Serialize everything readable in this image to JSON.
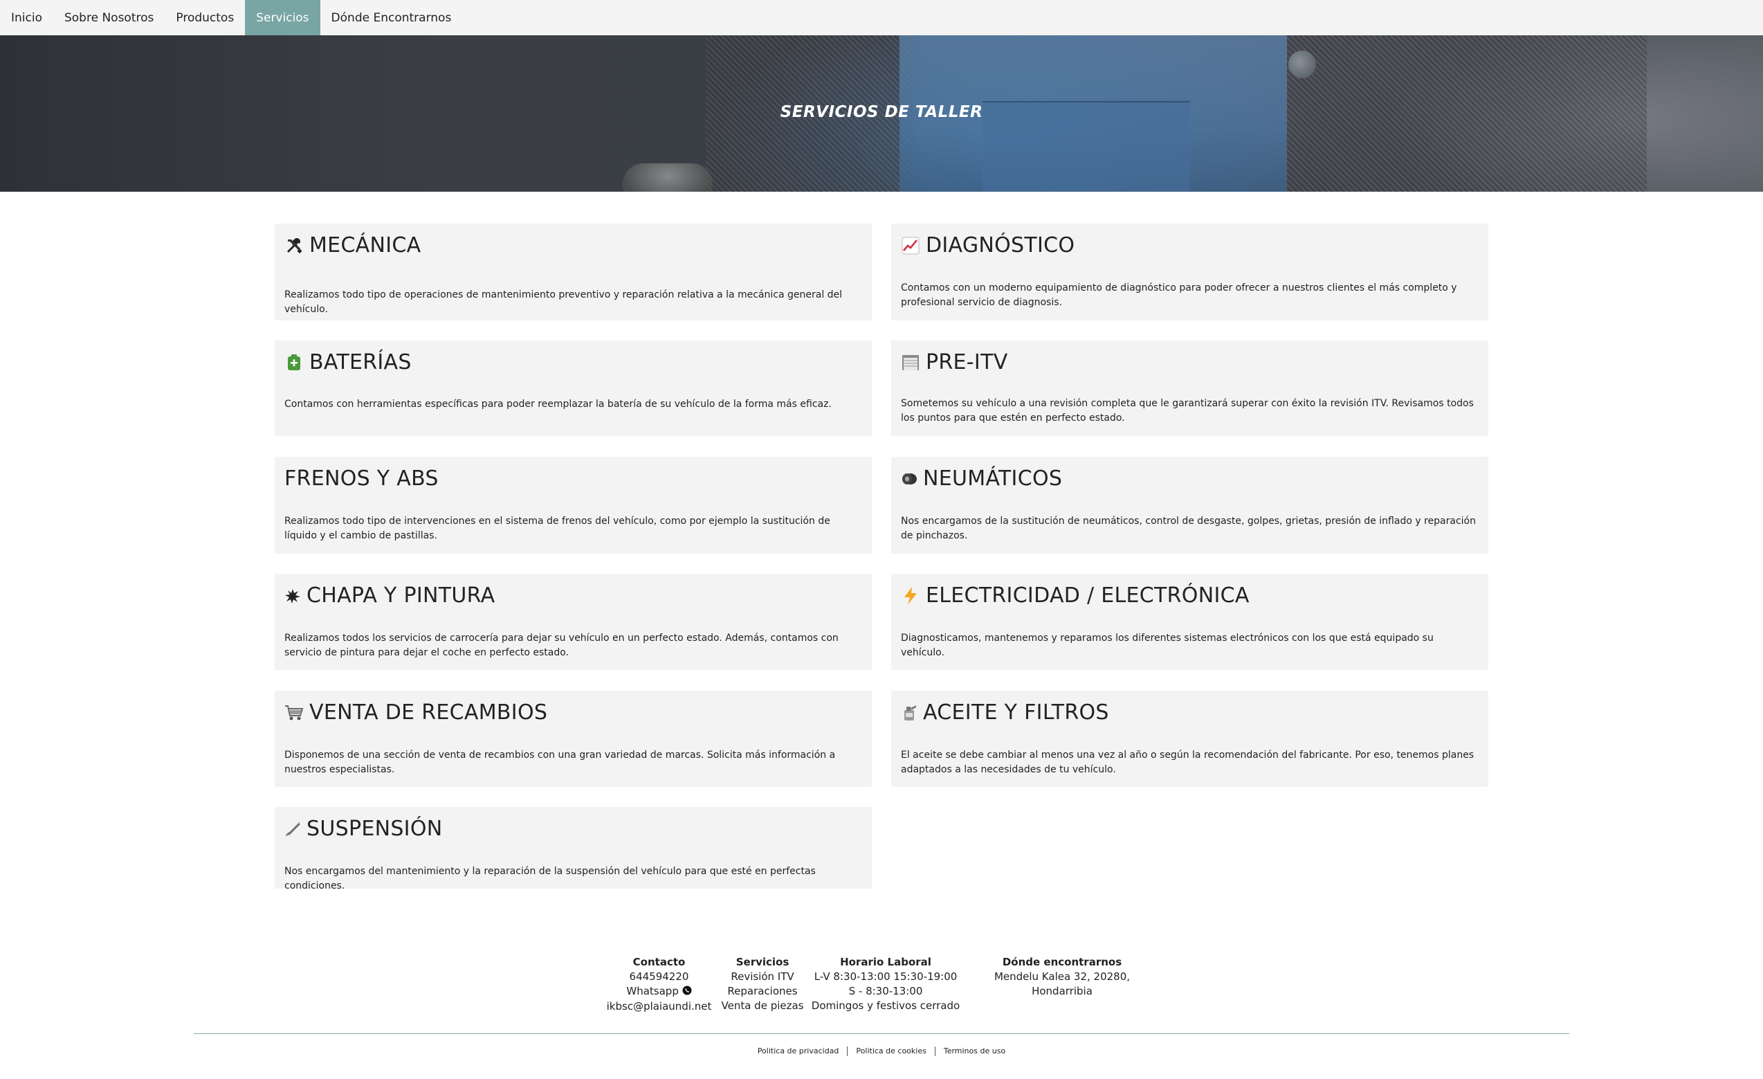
{
  "nav": {
    "items": [
      {
        "label": "Inicio"
      },
      {
        "label": "Sobre Nosotros"
      },
      {
        "label": "Productos"
      },
      {
        "label": "Servicios"
      },
      {
        "label": "Dónde Encontrarnos"
      }
    ],
    "active": "Servicios",
    "active_color": "#79a5a4"
  },
  "hero": {
    "title": "SERVICIOS DE TALLER"
  },
  "services": [
    {
      "icon": "tools-icon",
      "title": "MECÁNICA",
      "description": "Realizamos todo tipo de operaciones de mantenimiento preventivo y reparación relativa a la mecánica general del vehículo."
    },
    {
      "icon": "chart-icon",
      "title": "DIAGNÓSTICO",
      "description": "Contamos con un moderno equipamiento de diagnóstico para poder ofrecer a nuestros clientes el más completo y profesional servicio de diagnosis."
    },
    {
      "icon": "battery-icon",
      "title": "BATERÍAS",
      "description": "Contamos con herramientas específicas para poder reemplazar la batería de su vehículo de la forma más eficaz."
    },
    {
      "icon": "garage-icon",
      "title": "PRE-ITV",
      "description": "Sometemos su vehículo a una revisión completa que le garantizará superar con éxito la revisión ITV. Revisamos todos los puntos para que estén en perfecto estado."
    },
    {
      "icon": "",
      "title": "FRENOS Y ABS",
      "description": "Realizamos todo tipo de intervenciones en el sistema de frenos del vehículo, como por ejemplo la sustitución de líquido y el cambio de pastillas."
    },
    {
      "icon": "tire-icon",
      "title": "NEUMÁTICOS",
      "description": "Nos encargamos de la sustitución de neumáticos, control de desgaste, golpes, grietas, presión de inflado y reparación de pinchazos."
    },
    {
      "icon": "paint-splash-icon",
      "title": "CHAPA Y PINTURA",
      "description": "Realizamos todos los servicios de carrocería para dejar su vehículo en un perfecto estado. Además, contamos con servicio de pintura para dejar el coche en perfecto estado."
    },
    {
      "icon": "lightning-icon",
      "title": "ELECTRICIDAD / ELECTRÓNICA",
      "description": "Diagnosticamos, mantenemos y reparamos los diferentes sistemas electrónicos con los que está equipado su vehículo."
    },
    {
      "icon": "cart-icon",
      "title": "VENTA DE RECAMBIOS",
      "description": "Disponemos de una sección de venta de recambios con una gran variedad de marcas. Solicita más información a nuestros especialistas."
    },
    {
      "icon": "oil-can-icon",
      "title": "ACEITE Y FILTROS",
      "description": "El aceite se debe cambiar al menos una vez al año o según la recomendación del fabricante. Por eso, tenemos planes adaptados a las necesidades de tu vehículo."
    },
    {
      "icon": "spring-icon",
      "title": "SUSPENSIÓN",
      "description": "Nos encargamos del mantenimiento y la reparación de la suspensión del vehículo para que esté en perfectas condiciones."
    }
  ],
  "footer": {
    "contacto": {
      "heading": "Contacto",
      "phone": "644594220",
      "whatsapp": "Whatsapp",
      "email": "ikbsc@plaiaundi.net"
    },
    "servicios": {
      "heading": "Servicios",
      "items": [
        "Revisión ITV",
        "Reparaciones",
        "Venta de piezas"
      ]
    },
    "horario": {
      "heading": "Horario Laboral",
      "lines": [
        "L-V 8:30-13:00 15:30-19:00",
        "S - 8:30-13:00",
        "Domingos y festivos cerrado"
      ]
    },
    "donde": {
      "heading": "Dónde encontrarnos",
      "address": "Mendelu Kalea 32, 20280, Hondarribia"
    },
    "legal": [
      "Politica de privacidad",
      "Politica de cookies",
      "Terminos de uso"
    ],
    "line_color": "#7fa8a6"
  }
}
